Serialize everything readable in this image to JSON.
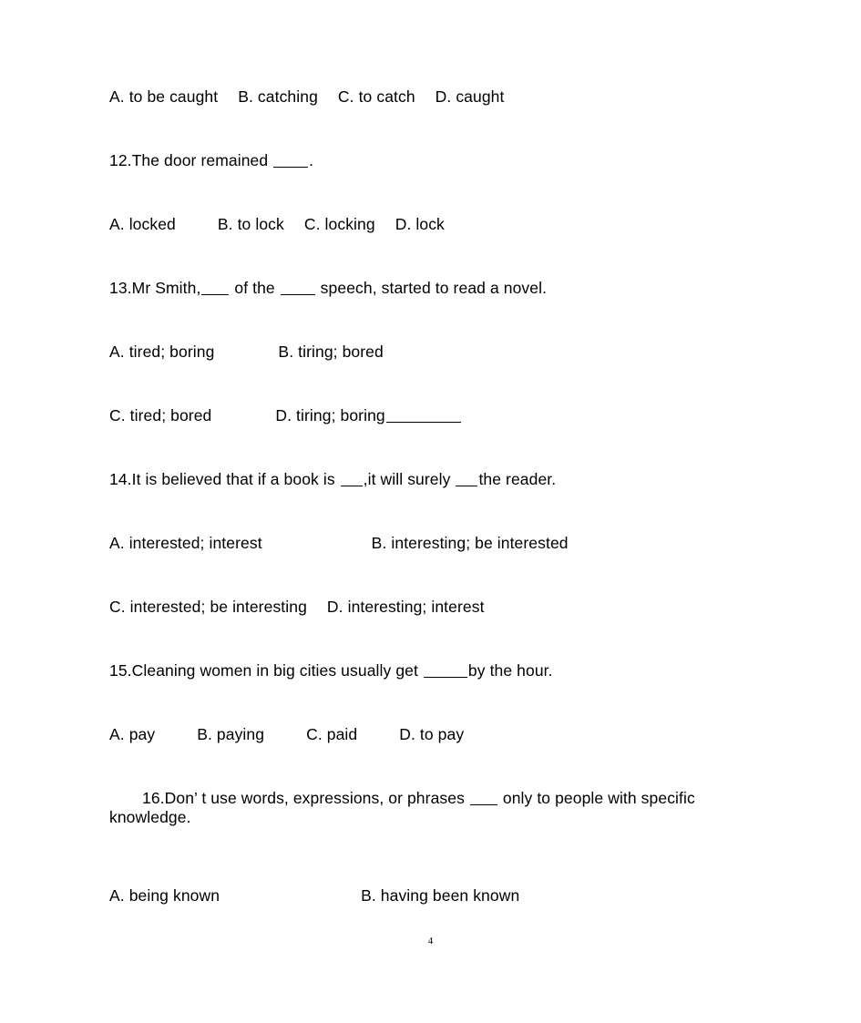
{
  "document": {
    "page_number": "4",
    "text_color": "#000000",
    "background_color": "#ffffff"
  },
  "content": {
    "q11_options": {
      "a": "A. to be caught",
      "b": "B. catching",
      "c": "C. to catch",
      "d": "D. caught"
    },
    "q12": {
      "number": "12.",
      "stem_before_blank": "The door remained ",
      "stem_after_blank": ".",
      "options": {
        "a": "A. locked",
        "b": "B. to lock",
        "c": "C. locking",
        "d": "D. lock"
      }
    },
    "q13": {
      "number": "13.",
      "stem_part1": "Mr Smith,",
      "stem_part2": " of the ",
      "stem_part3": " speech, started to read a novel.",
      "options": {
        "a": "A. tired; boring",
        "b": "B. tiring; bored",
        "c": "C. tired; bored",
        "d": "D. tiring; boring"
      }
    },
    "q14": {
      "number": "14.",
      "stem_part1": "It is believed that if a book is ",
      "stem_part2": ",it will surely ",
      "stem_part3": "the reader.",
      "options": {
        "a": "A. interested; interest",
        "b": "B. interesting; be interested",
        "c": "C. interested; be interesting",
        "d": "D. interesting; interest"
      }
    },
    "q15": {
      "number": "15.",
      "stem_part1": "Cleaning women in big cities usually get ",
      "stem_part2": "by the hour.",
      "options": {
        "a": "A. pay",
        "b": "B. paying",
        "c": "C. paid",
        "d": "D. to pay"
      }
    },
    "q16": {
      "number": "16.",
      "stem_part1": "Don’ t use words, expressions, or phrases ",
      "stem_part2": " only to people with specific",
      "stem_line2": "knowledge.",
      "options": {
        "a": "A. being known",
        "b": "B. having been known"
      }
    }
  }
}
